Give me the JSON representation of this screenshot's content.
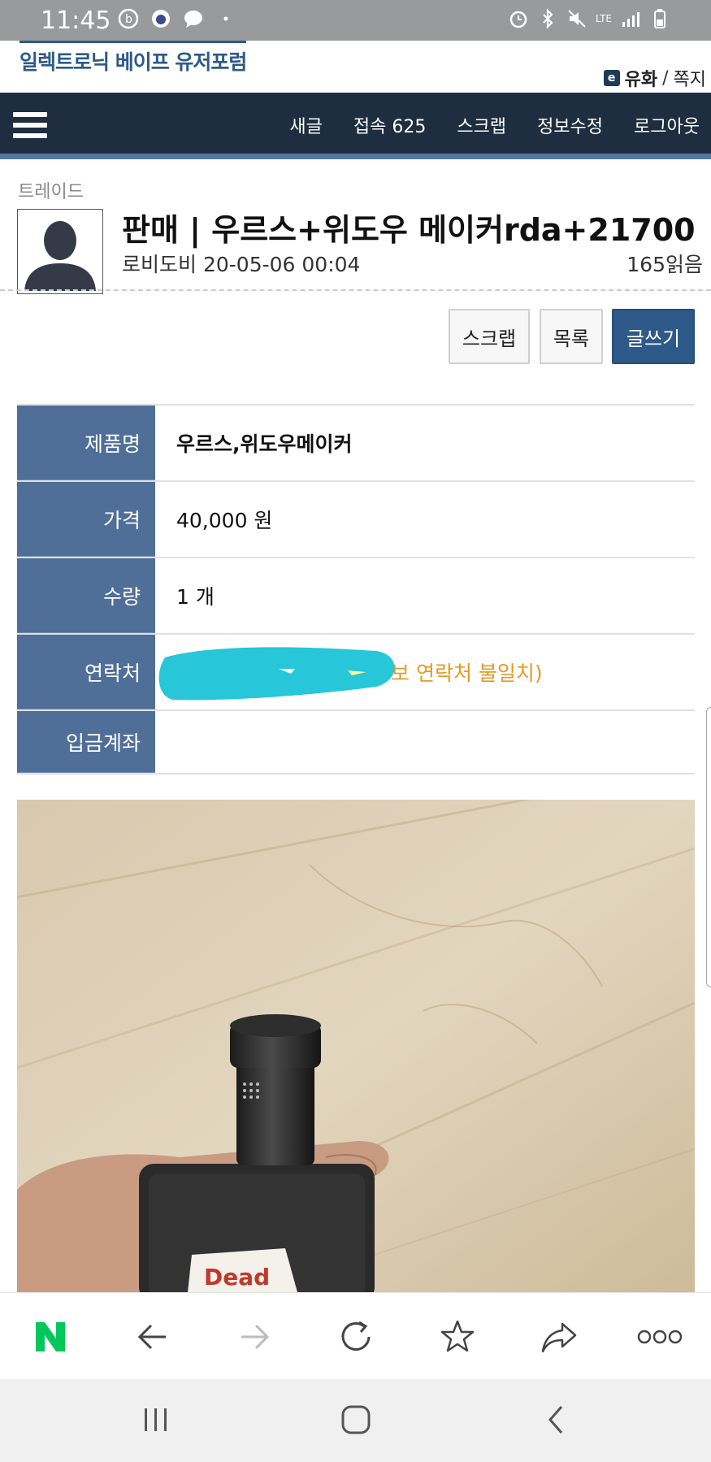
{
  "status_bar": {
    "time": "11:45",
    "network": "LTE"
  },
  "site": {
    "logo_text": "일렉트로닉 베이프 유저포럼",
    "user_link_icon": "e",
    "user_name": "유화",
    "messages": "쪽지",
    "separator": "/"
  },
  "nav": {
    "items": [
      "새글",
      "접속 625",
      "스크랩",
      "정보수정",
      "로그아웃"
    ]
  },
  "post": {
    "category": "트레이드",
    "title": "판매 | 우르스+위도우 메이커rda+21700",
    "author": "로비도비",
    "datetime": "20-05-06 00:04",
    "views": "165읽음"
  },
  "actions": {
    "scrap": "스크랩",
    "list": "목록",
    "write": "글쓰기"
  },
  "info": {
    "rows": [
      {
        "label": "제품명",
        "value": "우르스,위도우메이커"
      },
      {
        "label": "가격",
        "value": "40,000 원"
      },
      {
        "label": "수량",
        "value": "1 개"
      },
      {
        "label": "연락처",
        "value": "보 연락처 불일치)"
      },
      {
        "label": "입금계좌",
        "value": ""
      }
    ]
  },
  "photo": {
    "sticker_text": "Dead"
  },
  "icons": {
    "naver": "naver-logo",
    "back": "arrow-left-icon",
    "forward": "arrow-right-icon",
    "refresh": "refresh-icon",
    "bookmark": "star-icon",
    "share": "share-icon",
    "more": "more-icon"
  },
  "colors": {
    "nav_bg": "#1e2d40",
    "accent": "#2d5a88",
    "label_bg": "#4f6f98",
    "orange": "#e59a22",
    "redaction": "#27c6d9",
    "naver_green": "#03c75a"
  }
}
